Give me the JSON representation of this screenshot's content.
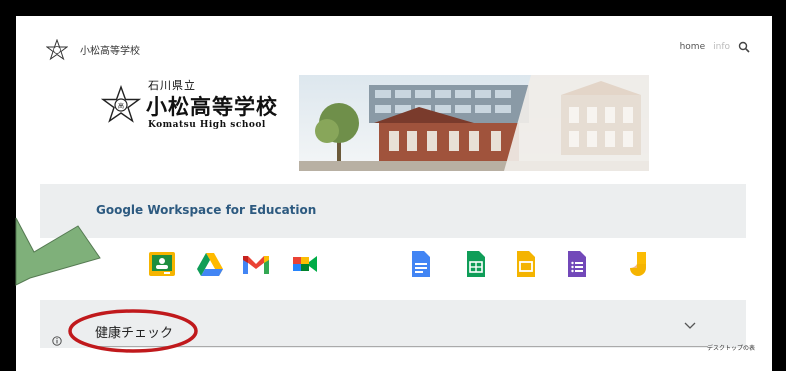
{
  "header": {
    "site_name": "小松高等学校",
    "nav": {
      "home": "home",
      "info": "info"
    },
    "icons": {
      "logo": "school-crest-icon",
      "search": "search-icon"
    }
  },
  "banner": {
    "prefecture": "石川県立",
    "school_name": "小松高等学校",
    "english_name": "Komatsu High school",
    "photo": "school-building-photo"
  },
  "workspace": {
    "title": "Google Workspace for Education",
    "apps": [
      "classroom-icon",
      "drive-icon",
      "gmail-icon",
      "meet-icon",
      "docs-icon",
      "sheets-icon",
      "slides-icon",
      "forms-icon",
      "jamboard-icon"
    ]
  },
  "health": {
    "label": "健康チェック",
    "desktop_note": "デスクトップの表"
  },
  "annotation": {
    "arrow_color": "#7fb07a",
    "circle_color": "#c0191c"
  },
  "colors": {
    "frame": "#000000",
    "band": "#eceeef",
    "title_blue": "#2d5a80"
  }
}
